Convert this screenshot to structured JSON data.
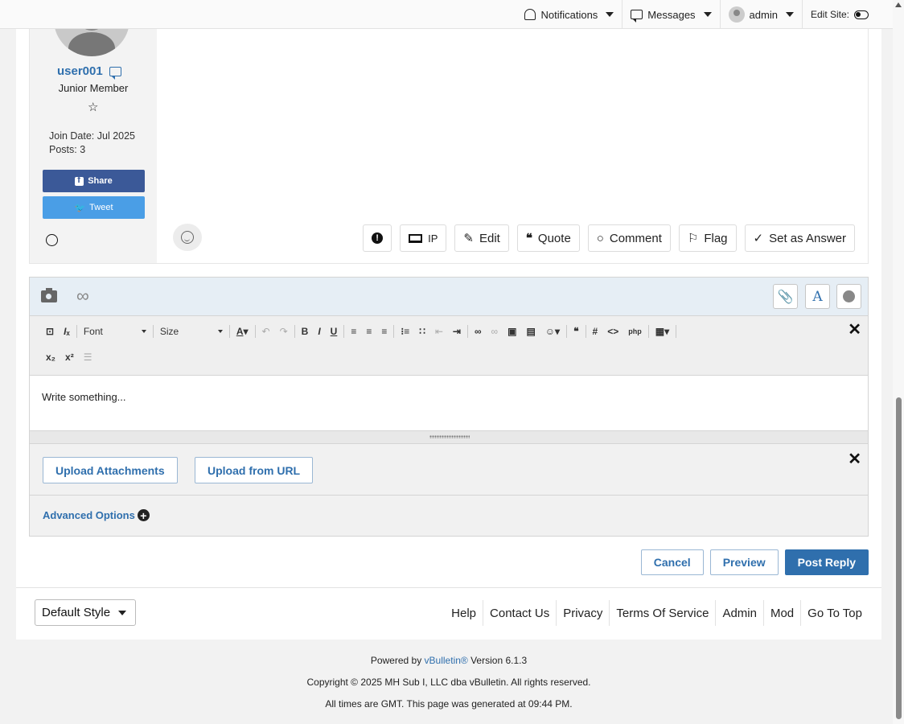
{
  "header": {
    "notifications_label": "Notifications",
    "messages_label": "Messages",
    "user_label": "admin",
    "edit_site_label": "Edit Site:"
  },
  "post": {
    "username": "user001",
    "rank": "Junior Member",
    "star_glyph": "☆",
    "join_date": "Join Date: Jul 2025",
    "posts": "Posts: 3",
    "share_label": "Share",
    "tweet_label": "Tweet",
    "actions": {
      "ip": "IP",
      "edit": "Edit",
      "quote": "Quote",
      "comment": "Comment",
      "flag": "Flag",
      "answer": "Set as Answer"
    }
  },
  "editor": {
    "font_label": "Font",
    "size_label": "Size",
    "placeholder": "Write something...",
    "upload_attachments_label": "Upload Attachments",
    "upload_url_label": "Upload from URL",
    "advanced_options_label": "Advanced Options"
  },
  "form_actions": {
    "cancel": "Cancel",
    "preview": "Preview",
    "post_reply": "Post Reply"
  },
  "footer": {
    "style_select_value": "Default Style",
    "links": [
      "Help",
      "Contact Us",
      "Privacy",
      "Terms Of Service",
      "Admin",
      "Mod",
      "Go To Top"
    ],
    "powered_by_prefix": "Powered by",
    "powered_by_brand": "vBulletin®",
    "powered_by_version": "Version 6.1.3",
    "copyright": "Copyright © 2025 MH Sub I, LLC dba vBulletin. All rights reserved.",
    "generated": "All times are GMT. This page was generated at 09:44 PM."
  },
  "colors": {
    "link_blue": "#2f6fad",
    "facebook": "#3b5998",
    "twitter": "#4a9ee6"
  }
}
